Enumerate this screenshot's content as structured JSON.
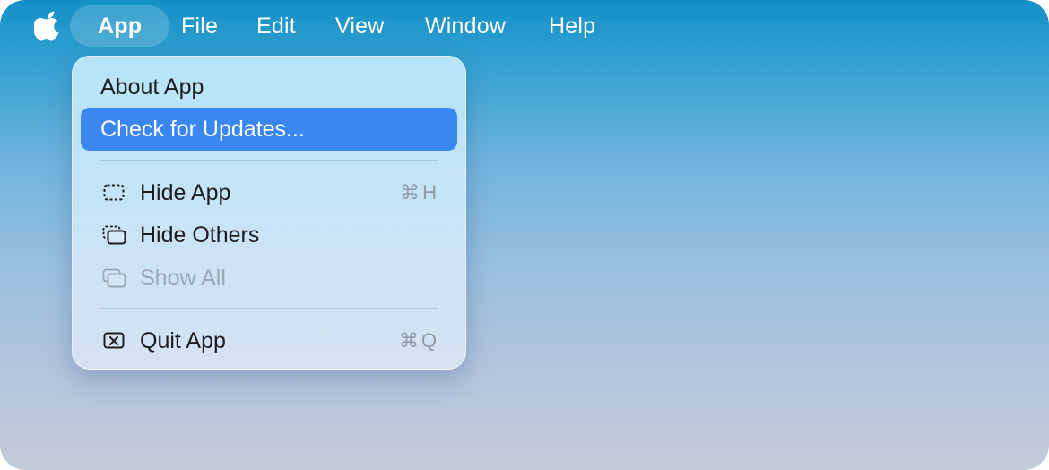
{
  "menubar": {
    "apple_icon": "apple-logo-icon",
    "items": [
      {
        "label": "App",
        "active": true
      },
      {
        "label": "File"
      },
      {
        "label": "Edit"
      },
      {
        "label": "View"
      },
      {
        "label": "Window"
      },
      {
        "label": "Help"
      }
    ]
  },
  "app_menu": {
    "items": [
      {
        "label": "About App"
      },
      {
        "label": "Check for Updates...",
        "highlighted": true
      },
      {
        "label": "Hide App",
        "icon": "hide-window-icon",
        "shortcut": "⌘H"
      },
      {
        "label": "Hide Others",
        "icon": "hide-others-icon"
      },
      {
        "label": "Show All",
        "icon": "show-all-icon",
        "disabled": true
      },
      {
        "label": "Quit App",
        "icon": "quit-icon",
        "shortcut": "⌘Q"
      }
    ]
  },
  "colors": {
    "highlight": "#3b87f2",
    "menubar_text": "#ffffff",
    "disabled_text": "#9aa7b5"
  }
}
